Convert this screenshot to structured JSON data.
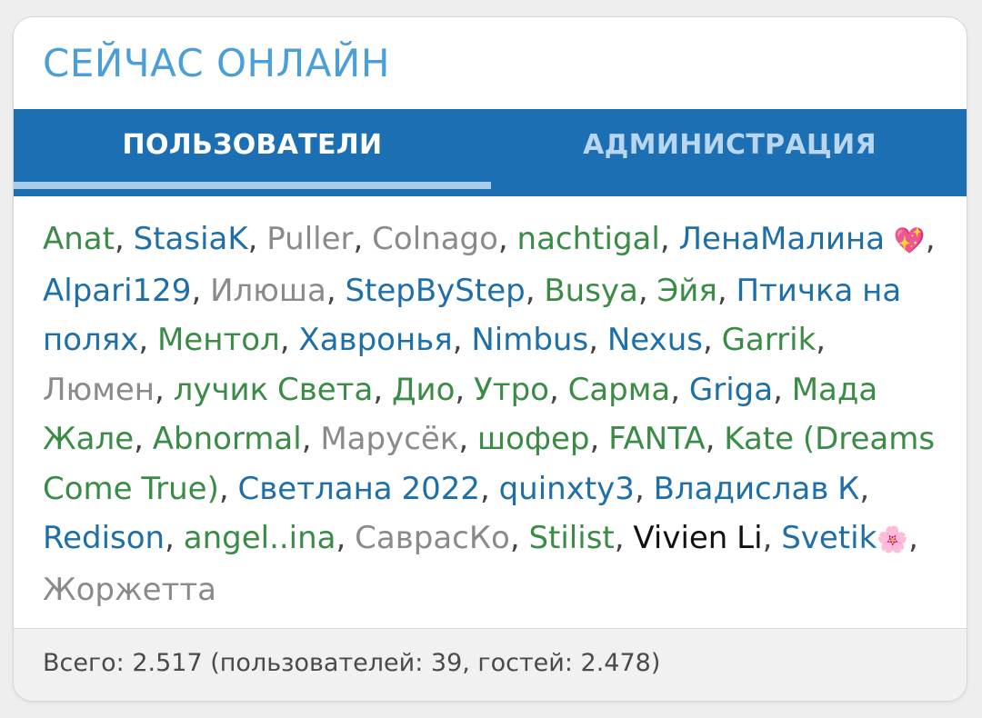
{
  "widget": {
    "title": "СЕЙЧАС ОНЛАЙН",
    "accent_color": "#1d6fb3"
  },
  "tabs": [
    {
      "label": "ПОЛЬЗОВАТЕЛИ",
      "active": true
    },
    {
      "label": "АДМИНИСТРАЦИЯ",
      "active": false
    }
  ],
  "users": [
    {
      "name": "Anat",
      "color": "green"
    },
    {
      "name": "StasiaK",
      "color": "blue"
    },
    {
      "name": "Puller",
      "color": "gray"
    },
    {
      "name": "Colnago",
      "color": "gray"
    },
    {
      "name": "nachtigal",
      "color": "green"
    },
    {
      "name": "ЛенаМалина",
      "color": "blue",
      "emoji": "💖"
    },
    {
      "name": "Alpari129",
      "color": "blue"
    },
    {
      "name": "Илюша",
      "color": "gray"
    },
    {
      "name": "StepByStep",
      "color": "blue"
    },
    {
      "name": "Busya",
      "color": "green"
    },
    {
      "name": "Эйя",
      "color": "green"
    },
    {
      "name": "Птичка на полях",
      "color": "blue"
    },
    {
      "name": "Ментол",
      "color": "green"
    },
    {
      "name": "Хавронья",
      "color": "blue"
    },
    {
      "name": "Nimbus",
      "color": "blue"
    },
    {
      "name": "Nexus",
      "color": "blue"
    },
    {
      "name": "Garrik",
      "color": "green"
    },
    {
      "name": "Люмен",
      "color": "gray"
    },
    {
      "name": "лучик Света",
      "color": "green"
    },
    {
      "name": "Дио",
      "color": "green"
    },
    {
      "name": "Утро",
      "color": "green"
    },
    {
      "name": "Сарма",
      "color": "green"
    },
    {
      "name": "Griga",
      "color": "blue"
    },
    {
      "name": "Мада Жале",
      "color": "green"
    },
    {
      "name": "Abnormal",
      "color": "green"
    },
    {
      "name": "Марусёк",
      "color": "gray"
    },
    {
      "name": "шофер",
      "color": "green"
    },
    {
      "name": "FANTA",
      "color": "green"
    },
    {
      "name": "Kate (Dreams Come True)",
      "color": "green"
    },
    {
      "name": "Светлана 2022",
      "color": "blue"
    },
    {
      "name": "quinxty3",
      "color": "blue"
    },
    {
      "name": "Владислав К",
      "color": "blue"
    },
    {
      "name": "Redison",
      "color": "blue"
    },
    {
      "name": "angel..ina",
      "color": "green"
    },
    {
      "name": "СаврасКо",
      "color": "gray"
    },
    {
      "name": "Stilist",
      "color": "green"
    },
    {
      "name": "Vivien Li",
      "color": "black"
    },
    {
      "name": "Svetik",
      "color": "blue",
      "emoji": "🌸"
    },
    {
      "name": "Жоржетта",
      "color": "gray"
    }
  ],
  "footer": {
    "text": "Всего: 2.517 (пользователей: 39, гостей: 2.478)"
  }
}
